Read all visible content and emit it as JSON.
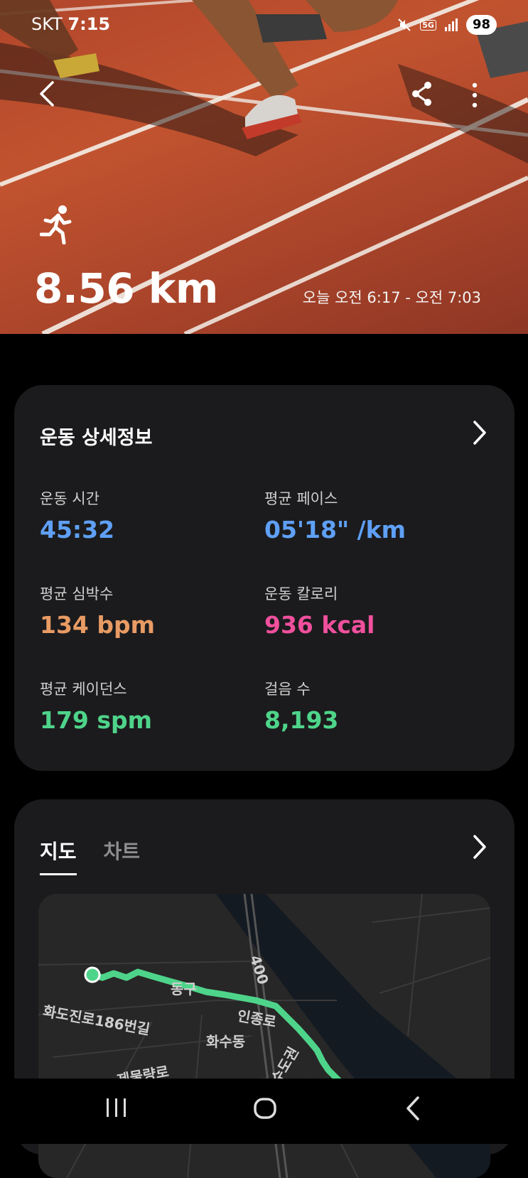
{
  "status_bar": {
    "carrier": "SKT",
    "time": "7:15",
    "network": "5G",
    "battery": "98"
  },
  "hero": {
    "activity_icon": "running-person-icon",
    "distance": "8.56 km",
    "time_range": "오늘 오전 6:17 - 오전 7:03"
  },
  "details_card": {
    "title": "운동 상세정보",
    "stats": [
      {
        "label": "운동 시간",
        "value": "45:32",
        "color": "#5fa0f6"
      },
      {
        "label": "평균 페이스",
        "value": "05'18\" /km",
        "color": "#5fa0f6"
      },
      {
        "label": "평균 심박수",
        "value": "134 bpm",
        "color": "#e89b64"
      },
      {
        "label": "운동 칼로리",
        "value": "936 kcal",
        "color": "#f0509d"
      },
      {
        "label": "평균 케이던스",
        "value": "179 spm",
        "color": "#4ed48a"
      },
      {
        "label": "걸음 수",
        "value": "8,193",
        "color": "#4ed48a"
      }
    ]
  },
  "map_card": {
    "tabs": [
      {
        "label": "지도",
        "active": true
      },
      {
        "label": "차트",
        "active": false
      }
    ],
    "map_labels": {
      "district": "동구",
      "road_main": "인종로",
      "road_number": "400",
      "area": "화수동",
      "street_1": "화도진로186번길",
      "street_2": "제물량로",
      "street_3": "수도권"
    },
    "route_color": "#4ed48a"
  }
}
